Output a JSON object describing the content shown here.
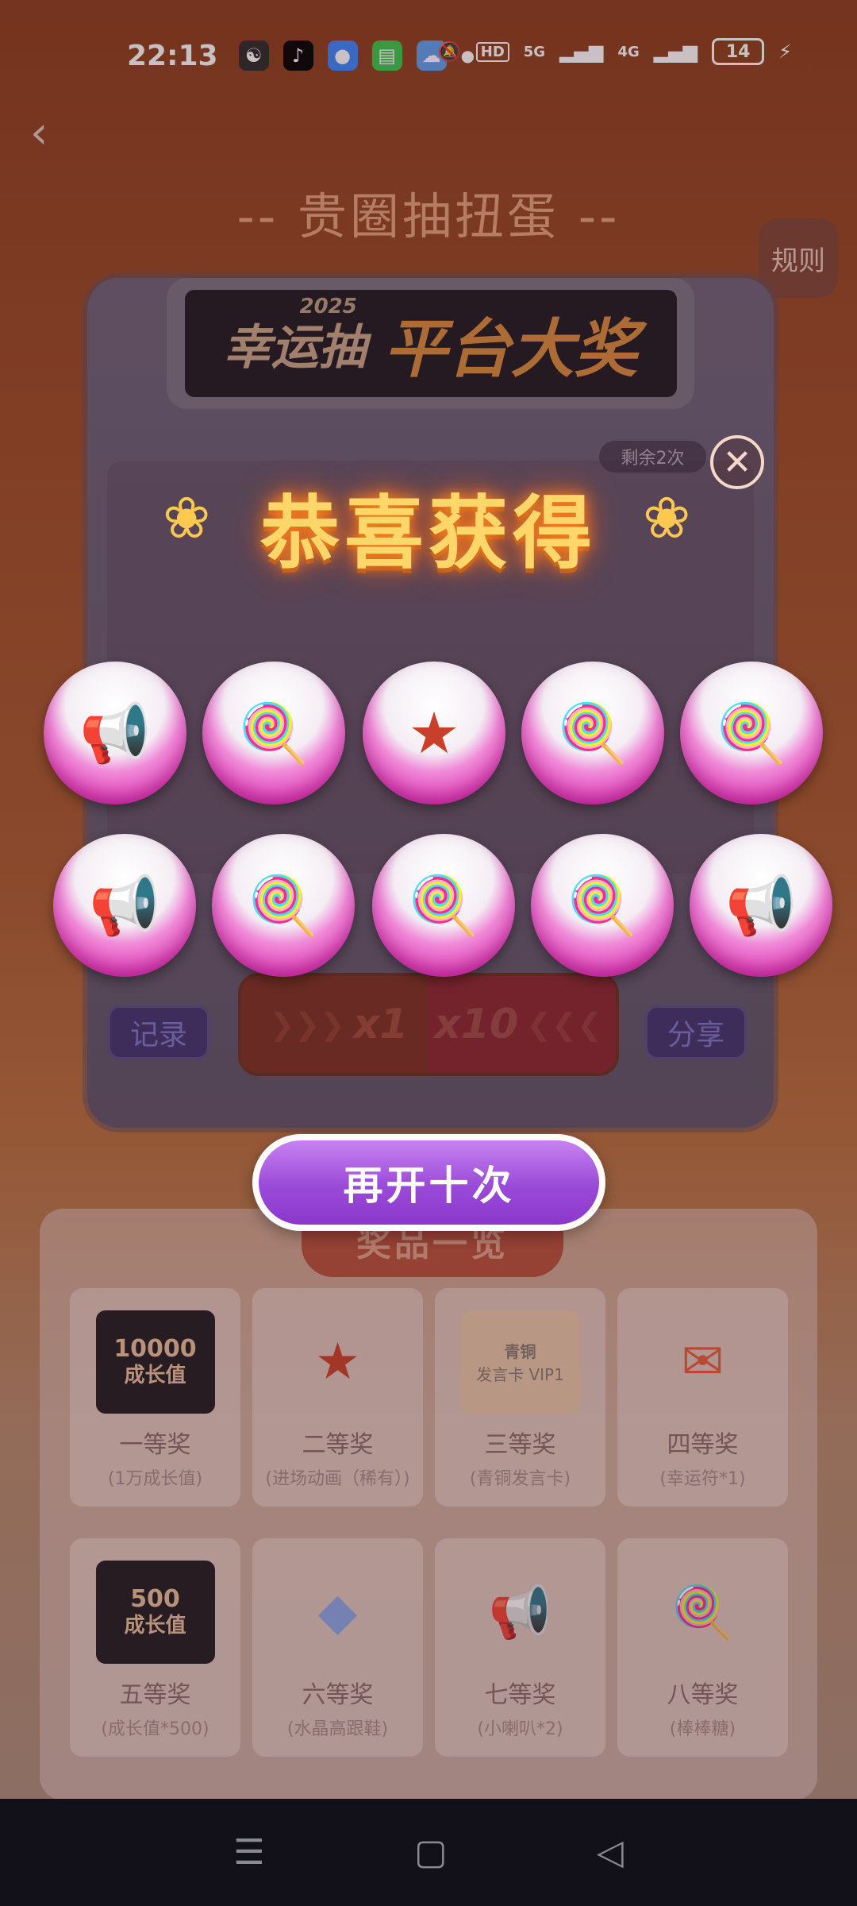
{
  "status_bar": {
    "time": "22:13",
    "hd_label": "HD",
    "net_5g": "5G",
    "net_4g": "4G",
    "battery": "14"
  },
  "page": {
    "title": "-- 贵圈抽扭蛋 --",
    "rules_label": "规则"
  },
  "machine": {
    "banner_year": "2025",
    "banner_lead": "幸运抽",
    "banner_main": "平台大奖",
    "remaining": "剩余2次",
    "record_label": "记录",
    "share_label": "分享",
    "draw_once": "x1",
    "draw_ten": "x10"
  },
  "result": {
    "title": "恭喜获得",
    "capsules": [
      {
        "prize": "horn"
      },
      {
        "prize": "lollipop"
      },
      {
        "prize": "character"
      },
      {
        "prize": "lollipop"
      },
      {
        "prize": "lollipop"
      },
      {
        "prize": "horn"
      },
      {
        "prize": "lollipop"
      },
      {
        "prize": "lollipop"
      },
      {
        "prize": "lollipop"
      },
      {
        "prize": "horn"
      }
    ],
    "again_label": "再开十次"
  },
  "prizes": {
    "header": "奖品一览",
    "items": [
      {
        "name": "一等奖",
        "desc": "(1万成长值)",
        "art_line1": "10000",
        "art_line2": "成长值"
      },
      {
        "name": "二等奖",
        "desc": "(进场动画（稀有）)"
      },
      {
        "name": "三等奖",
        "desc": "(青铜发言卡)",
        "art_line1": "青铜",
        "art_line2": "发言卡 VIP1"
      },
      {
        "name": "四等奖",
        "desc": "(幸运符*1)"
      },
      {
        "name": "五等奖",
        "desc": "(成长值*500)",
        "art_line1": "500",
        "art_line2": "成长值"
      },
      {
        "name": "六等奖",
        "desc": "(水晶高跟鞋)"
      },
      {
        "name": "七等奖",
        "desc": "(小喇叭*2)"
      },
      {
        "name": "八等奖",
        "desc": "(棒棒糖)"
      }
    ]
  }
}
